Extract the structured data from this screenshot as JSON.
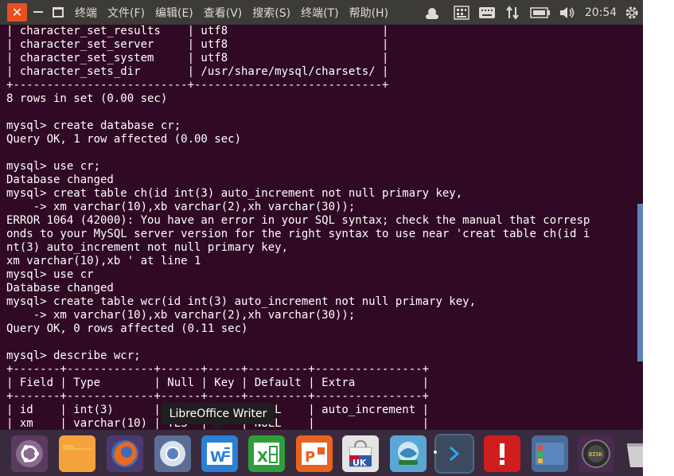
{
  "menubar": {
    "items": [
      "终端",
      "文件(F)",
      "编辑(E)",
      "查看(V)",
      "搜索(S)",
      "终端(T)",
      "帮助(H)"
    ]
  },
  "tray": {
    "icons": [
      "weather-icon",
      "keyboard-layout-icon",
      "keyboard-icon",
      "network-icon",
      "battery-icon",
      "volume-icon"
    ],
    "clock": "20:54"
  },
  "terminal": {
    "lines": [
      "| character_set_results    | utf8                       |",
      "| character_set_server     | utf8                       |",
      "| character_set_system     | utf8                       |",
      "| character_sets_dir       | /usr/share/mysql/charsets/ |",
      "+--------------------------+----------------------------+",
      "8 rows in set (0.00 sec)",
      "",
      "mysql> create database cr;",
      "Query OK, 1 row affected (0.00 sec)",
      "",
      "mysql> use cr;",
      "Database changed",
      "mysql> creat table ch(id int(3) auto_increment not null primary key,",
      "    -> xm varchar(10),xb varchar(2),xh varchar(30));",
      "ERROR 1064 (42000): You have an error in your SQL syntax; check the manual that corresp",
      "onds to your MySQL server version for the right syntax to use near 'creat table ch(id i",
      "nt(3) auto_increment not null primary key,",
      "xm varchar(10),xb ' at line 1",
      "mysql> use cr",
      "Database changed",
      "mysql> create table wcr(id int(3) auto_increment not null primary key,",
      "    -> xm varchar(10),xb varchar(2),xh varchar(30));",
      "Query OK, 0 rows affected (0.11 sec)",
      "",
      "mysql> describe wcr;",
      "+-------+-------------+------+-----+---------+----------------+",
      "| Field | Type        | Null | Key | Default | Extra          |",
      "+-------+-------------+------+-----+---------+----------------+",
      "| id    | int(3)      | NO   | PRI | NULL    | auto_increment |",
      "| xm    | varchar(10) | YES  |     | NULL    |                |"
    ]
  },
  "dock": {
    "items": [
      {
        "name": "ubuntu-dash-icon",
        "color": "#5a3b5e"
      },
      {
        "name": "files-folder-icon",
        "color": "#f4a23c"
      },
      {
        "name": "firefox-icon",
        "color": "#e66a21"
      },
      {
        "name": "chromium-icon",
        "color": "#5b7fc4"
      },
      {
        "name": "libreoffice-writer-icon",
        "color": "#2a7fd6"
      },
      {
        "name": "libreoffice-calc-icon",
        "color": "#2e9e3a"
      },
      {
        "name": "libreoffice-impress-icon",
        "color": "#e8631f"
      },
      {
        "name": "ubuntu-software-center-icon",
        "color": "#e4e4e4"
      },
      {
        "name": "network-share-icon",
        "color": "#5aa7d6"
      },
      {
        "name": "terminal-icon",
        "color": "#3b4a5e"
      },
      {
        "name": "software-updater-alert-icon",
        "color": "#d01e1e"
      },
      {
        "name": "workspace-switcher-icon",
        "color": "#4a6c9a"
      },
      {
        "name": "disk-icon",
        "color": "#2c2c2c"
      },
      {
        "name": "trash-icon",
        "color": "#cfcfcf"
      }
    ],
    "tooltip": "LibreOffice Writer"
  }
}
